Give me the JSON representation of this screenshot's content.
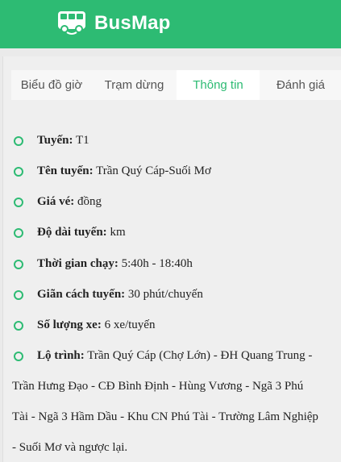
{
  "app": {
    "brand": "BusMap",
    "accent_color": "#2dbb73",
    "logo_icon": "bus-icon"
  },
  "tabs": [
    {
      "label": "Biểu đồ giờ",
      "active": false
    },
    {
      "label": "Trạm dừng",
      "active": false
    },
    {
      "label": "Thông tin",
      "active": true
    },
    {
      "label": "Đánh giá",
      "active": false
    }
  ],
  "info": {
    "route_label": "Tuyến:",
    "route_value": "T1",
    "name_label": "Tên tuyến:",
    "name_value": "Trần Quý Cáp-Suối Mơ",
    "fare_label": "Giá vé:",
    "fare_value": "đồng",
    "length_label": "Độ dài tuyến:",
    "length_value": "km",
    "hours_label": "Thời gian chạy:",
    "hours_value": "5:40h - 18:40h",
    "interval_label": "Giãn cách tuyến:",
    "interval_value": "30 phút/chuyến",
    "buses_label": "Số lượng xe:",
    "buses_value": "6 xe/tuyến",
    "itinerary_label": "Lộ trình:",
    "itinerary_lines": [
      "Trần Quý Cáp (Chợ Lớn) - ĐH Quang Trung -",
      "Trần Hưng Đạo - CĐ Bình Định - Hùng Vương - Ngã 3 Phú",
      "Tài - Ngã 3 Hầm Dầu - Khu CN Phú Tài - Trường Lâm Nghiệp",
      "- Suối Mơ và ngược lại."
    ]
  }
}
